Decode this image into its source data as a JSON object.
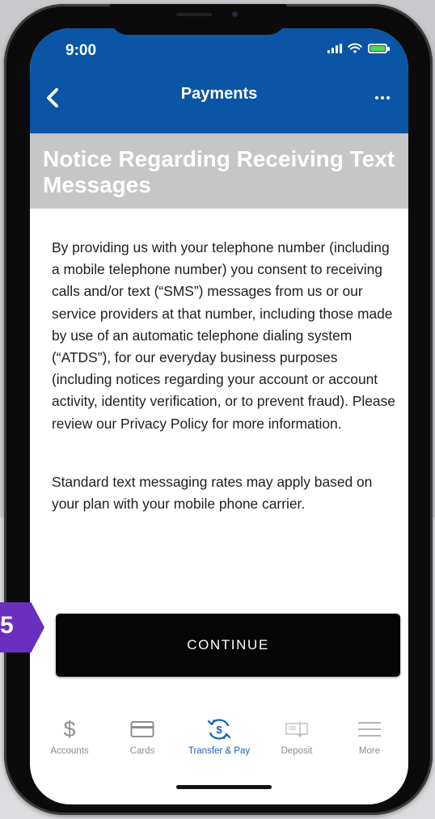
{
  "status_bar": {
    "time": "9:00"
  },
  "header": {
    "title": "Payments"
  },
  "notice": {
    "heading": "Notice Regarding Receiving Text Messages",
    "paragraph_1": "By providing us with your telephone number (including a mobile telephone number) you consent to receiving calls and/or text (“SMS”) messages from us or our service providers at that number, including those made by use of an automatic telephone dialing system (“ATDS”), for our everyday business purposes (including notices regarding your account or account activity, identity verification, or to prevent fraud). Please review our Privacy Policy for more information.",
    "paragraph_2": "Standard text messaging rates may apply based on your plan with your mobile phone carrier."
  },
  "continue_button": {
    "label": "CONTINUE"
  },
  "tabs": [
    {
      "label": "Accounts",
      "icon": "dollar-icon",
      "active": false
    },
    {
      "label": "Cards",
      "icon": "card-icon",
      "active": false
    },
    {
      "label": "Transfer & Pay",
      "icon": "transfer-pay-icon",
      "active": true
    },
    {
      "label": "Deposit",
      "icon": "deposit-check-icon",
      "active": false
    },
    {
      "label": "More",
      "icon": "menu-icon",
      "active": false
    }
  ],
  "step_badge": {
    "number": "5"
  },
  "colors": {
    "header_blue": "#0a55a6",
    "active_tab": "#1763b8",
    "badge_purple": "#6b2fbf",
    "notice_gray": "#c6c6c6"
  }
}
